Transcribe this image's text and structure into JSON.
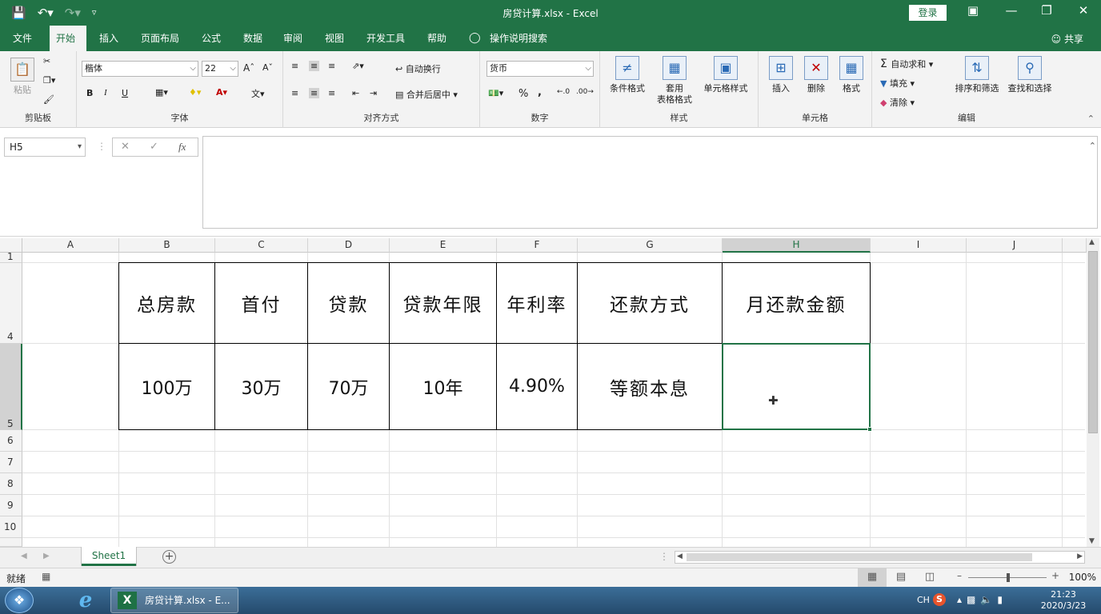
{
  "titlebar": {
    "title": "房贷计算.xlsx  -  Excel",
    "login": "登录",
    "qat_icons": [
      "save-icon",
      "undo-icon",
      "redo-icon",
      "customize-qat-icon"
    ],
    "window_controls": [
      "ribbon-display-icon",
      "minimize-icon",
      "restore-icon",
      "close-icon"
    ]
  },
  "tabs": {
    "items": [
      {
        "label": "文件"
      },
      {
        "label": "开始"
      },
      {
        "label": "插入"
      },
      {
        "label": "页面布局"
      },
      {
        "label": "公式"
      },
      {
        "label": "数据"
      },
      {
        "label": "审阅"
      },
      {
        "label": "视图"
      },
      {
        "label": "开发工具"
      },
      {
        "label": "帮助"
      },
      {
        "label": "操作说明搜索"
      }
    ],
    "active": "开始",
    "share": "共享"
  },
  "ribbon": {
    "clipboard": {
      "paste": "粘贴",
      "label": "剪贴板"
    },
    "font": {
      "name": "楷体",
      "size": "22",
      "bold": "B",
      "italic": "I",
      "underline": "U",
      "label": "字体"
    },
    "alignment": {
      "wrap": "自动换行",
      "merge": "合并后居中",
      "label": "对齐方式"
    },
    "number": {
      "format": "货币",
      "percent": "%",
      "comma": ",",
      "label": "数字"
    },
    "styles": {
      "conditional": "条件格式",
      "table_line1": "套用",
      "table_line2": "表格格式",
      "cell_styles": "单元格样式",
      "label": "样式"
    },
    "cells": {
      "insert": "插入",
      "delete": "删除",
      "format": "格式",
      "label": "单元格"
    },
    "editing": {
      "autosum": "自动求和",
      "fill": "填充",
      "clear": "清除",
      "sort": "排序和筛选",
      "find": "查找和选择",
      "label": "编辑"
    }
  },
  "formula_bar": {
    "name_box": "H5",
    "formula": ""
  },
  "grid": {
    "columns": [
      "A",
      "B",
      "C",
      "D",
      "E",
      "F",
      "G",
      "H",
      "I",
      "J"
    ],
    "selected_column": "H",
    "rows": [
      "1",
      "4",
      "5",
      "6",
      "7",
      "8",
      "9",
      "10"
    ],
    "selected_row": "5",
    "table": {
      "headers": [
        "总房款",
        "首付",
        "贷款",
        "贷款年限",
        "年利率",
        "还款方式",
        "月还款金额"
      ],
      "values": [
        "100万",
        "30万",
        "70万",
        "10年",
        "4.90%",
        "等额本息",
        ""
      ]
    },
    "selected_cell": "H5"
  },
  "sheets": {
    "tabs": [
      "Sheet1"
    ],
    "active": "Sheet1"
  },
  "status": {
    "ready": "就绪",
    "zoom": "100%"
  },
  "taskbar": {
    "excel_task": "房贷计算.xlsx - E...",
    "lang": "CH",
    "time": "21:23",
    "date": "2020/3/23"
  }
}
